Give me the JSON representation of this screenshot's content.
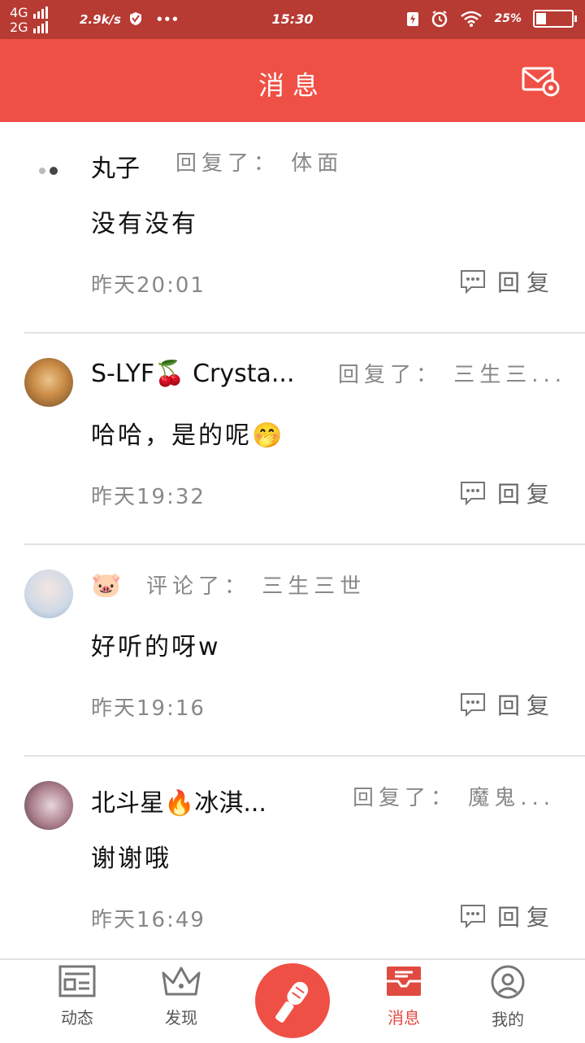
{
  "status_bar": {
    "net1": "4G",
    "net2": "2G",
    "speed": "2.9k/s",
    "dots": "•••",
    "time": "15:30",
    "battery_pct": "25%",
    "battery_level": 0.25
  },
  "header": {
    "title": "消息"
  },
  "messages": [
    {
      "name": "丸子",
      "action": "回复了：",
      "target": "体面",
      "text": "没有没有",
      "time": "昨天20:01",
      "reply_label": "回复"
    },
    {
      "name": "S-LYF🍒 Crysta...",
      "action": "回复了：",
      "target": "三生三...",
      "text": "哈哈，是的呢🤭",
      "time": "昨天19:32",
      "reply_label": "回复"
    },
    {
      "name": "🐷",
      "action": "评论了：",
      "target": "三生三世",
      "text": "好听的呀w",
      "time": "昨天19:16",
      "reply_label": "回复"
    },
    {
      "name": "北斗星🔥冰淇...",
      "action": "回复了：",
      "target": "魔鬼...",
      "text": "谢谢哦",
      "time": "昨天16:49",
      "reply_label": "回复"
    }
  ],
  "tabs": [
    {
      "label": "动态",
      "icon": "news-icon"
    },
    {
      "label": "发现",
      "icon": "crown-icon"
    },
    {
      "label": "",
      "icon": "microphone-icon"
    },
    {
      "label": "消息",
      "icon": "message-icon"
    },
    {
      "label": "我的",
      "icon": "profile-icon"
    }
  ]
}
